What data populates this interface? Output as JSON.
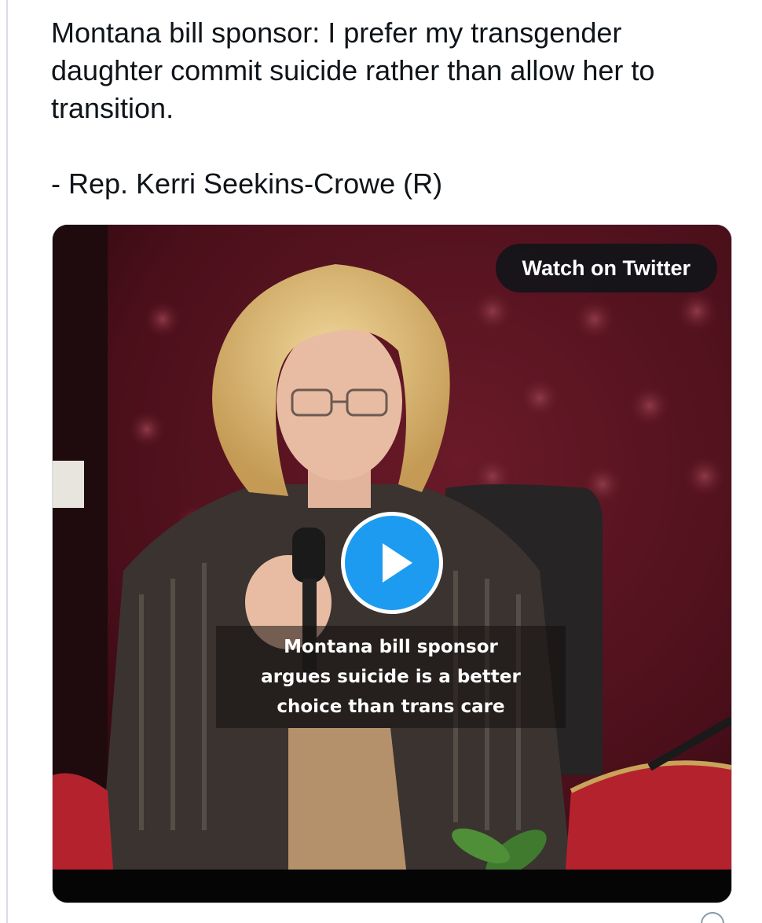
{
  "tweet": {
    "text_lines": [
      "Montana bill sponsor: I prefer my transgender",
      "daughter commit suicide rather than allow her to",
      "transition."
    ],
    "attribution": "- Rep. Kerri Seekins-Crowe (R)"
  },
  "video": {
    "watch_label": "Watch on Twitter",
    "play_icon": "play-icon",
    "caption_lines": [
      "Montana bill sponsor",
      "argues suicide is a better",
      "choice than trans care"
    ],
    "colors": {
      "play_button": "#1d9bf0",
      "backdrop": "#5a1420",
      "jacket": "#3a3330",
      "chair_red": "#b4232d"
    }
  }
}
